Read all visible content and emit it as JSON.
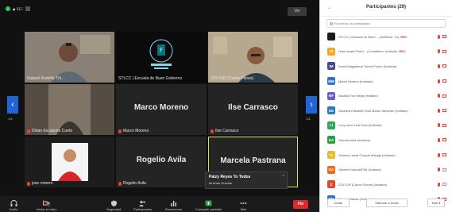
{
  "meeting": {
    "view_label": "Ver",
    "page_indicator_left": "1/4",
    "page_indicator_right": "1/4",
    "tiles": [
      {
        "id": "t1",
        "name": "Gabriel Rodolfo Tril...",
        "mode": "video",
        "bg": "#7b7368"
      },
      {
        "id": "t2",
        "name": "STLCC | Escuela de Buen Gobierno",
        "mode": "logo",
        "bg": "#0b0b0b",
        "logo_text": "ESCUELA DE BUEN GOBIERNO"
      },
      {
        "id": "t3",
        "name": "ZOLTUR (Carlos Flores)",
        "mode": "video",
        "bg": "#9a8d78"
      },
      {
        "id": "t4",
        "name": "Dirlan Escalante Cueto",
        "mode": "video",
        "bg": "#6e6559",
        "mic_off": true
      },
      {
        "id": "t5",
        "name": "Marco Moreno",
        "mode": "name",
        "big": "Marco Moreno",
        "mic_off": true
      },
      {
        "id": "t6",
        "name": "Ilse Carrasco",
        "mode": "name",
        "big": "Ilse Carrasco",
        "mic_off": true
      },
      {
        "id": "t7",
        "name": "jose romero",
        "mode": "video",
        "bg": "#ffffff",
        "mic_off": true
      },
      {
        "id": "t8",
        "name": "Rogelio Avila",
        "mode": "name",
        "big": "Rogelio Avila",
        "mic_off": true
      },
      {
        "id": "t9",
        "name": "",
        "mode": "name",
        "big": "Marcela Pastrana",
        "active": true
      }
    ],
    "chat_toast": {
      "line1": "Patzy Reyes To Todos",
      "line2": "Muchas Gracias",
      "close": "×"
    },
    "toolbar": [
      {
        "label": "Audio",
        "icon": "headphones-icon"
      },
      {
        "label": "Iniciar el video",
        "icon": "camera-off-icon"
      },
      {
        "label": "Seguridad",
        "icon": "shield-icon"
      },
      {
        "label": "Participantes",
        "icon": "participants-icon",
        "count": "29"
      },
      {
        "label": "Reacciones",
        "icon": "reactions-icon"
      },
      {
        "label": "Compartir pantalla",
        "icon": "share-screen-icon"
      },
      {
        "label": "Más",
        "icon": "more-icon"
      }
    ],
    "end_label": "Fin"
  },
  "panel": {
    "title": "Participantes (29)",
    "search_placeholder": "Encontrar un participante",
    "participants": [
      {
        "initials": "",
        "name": "STLCC | Escuela de Buen ... (Anfitrión, Yo)",
        "rec": "REC",
        "color": "#1a1a1a",
        "cam": "red"
      },
      {
        "initials": "HI",
        "name": "Hans Israel Pined... (Coanfitrión, Invitado)",
        "rec": "REC",
        "color": "#f5a623",
        "cam": "red"
      },
      {
        "initials": "IM",
        "name": "Irania Magdalena Torres Ponce (Invitado)",
        "rec": "",
        "color": "#4a4a8a",
        "cam": "red"
      },
      {
        "initials": "MM",
        "name": "Marco Moreno (Invitado)",
        "rec": "",
        "color": "#2f74c0",
        "cam": "red"
      },
      {
        "initials": "NF",
        "name": "Nuvilad Flor Mejia (Invitado)",
        "rec": "",
        "color": "#6b5fc4",
        "cam": "red"
      },
      {
        "initials": "GE",
        "name": "Gabriela Elizabeth San Martín Sanchez (Invitado)",
        "rec": "",
        "color": "#2b7bb9",
        "cam": "red"
      },
      {
        "initials": "LI",
        "name": "Lucy Irene Leal Díaz (Invitado)",
        "rec": "",
        "color": "#2fa85a",
        "cam": "red"
      },
      {
        "initials": "GA",
        "name": "Glenda Avila (Invitado)",
        "rec": "",
        "color": "#27a043",
        "cam": "red"
      },
      {
        "initials": "YL",
        "name": "Yoanna Lizeth Chapas Arriaga (Invitado)",
        "rec": "",
        "color": "#e8b931",
        "cam": "red"
      },
      {
        "initials": "GA",
        "name": "Gabriel Kanune(FM) (Invitado)",
        "rec": "",
        "color": "#e86a1c",
        "cam": "gray"
      },
      {
        "initials": "Z",
        "name": "ZOLTUR (Carlos Flores) (Invitado)",
        "rec": "",
        "color": "#dd4a2f",
        "cam": "gray"
      },
      {
        "initials": "SN",
        "name": "Sandra Navas (Invitado)",
        "rec": "",
        "color": "#3270c8",
        "cam": "red"
      }
    ],
    "buttons": {
      "invite": "Invitar",
      "mute_all": "Silenciar a todos",
      "more": "Más ▾"
    }
  },
  "colors": {
    "accent_blue": "#1f65d6",
    "end_red": "#e02828",
    "active_border": "#d7e35a"
  }
}
